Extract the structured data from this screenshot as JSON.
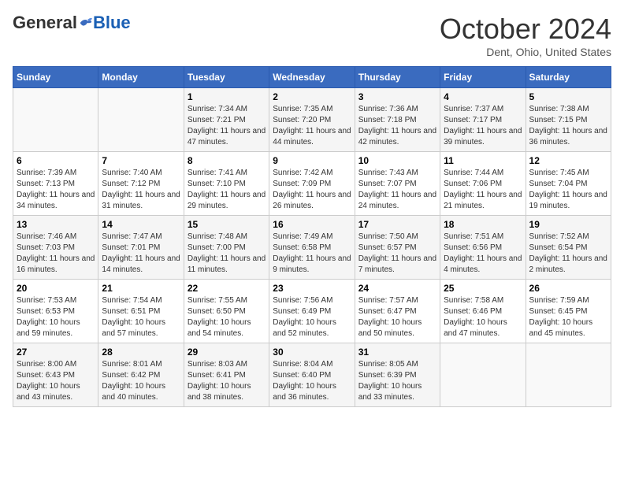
{
  "header": {
    "logo_general": "General",
    "logo_blue": "Blue",
    "month_title": "October 2024",
    "location": "Dent, Ohio, United States"
  },
  "days_of_week": [
    "Sunday",
    "Monday",
    "Tuesday",
    "Wednesday",
    "Thursday",
    "Friday",
    "Saturday"
  ],
  "weeks": [
    [
      {
        "day": "",
        "sunrise": "",
        "sunset": "",
        "daylight": ""
      },
      {
        "day": "",
        "sunrise": "",
        "sunset": "",
        "daylight": ""
      },
      {
        "day": "1",
        "sunrise": "Sunrise: 7:34 AM",
        "sunset": "Sunset: 7:21 PM",
        "daylight": "Daylight: 11 hours and 47 minutes."
      },
      {
        "day": "2",
        "sunrise": "Sunrise: 7:35 AM",
        "sunset": "Sunset: 7:20 PM",
        "daylight": "Daylight: 11 hours and 44 minutes."
      },
      {
        "day": "3",
        "sunrise": "Sunrise: 7:36 AM",
        "sunset": "Sunset: 7:18 PM",
        "daylight": "Daylight: 11 hours and 42 minutes."
      },
      {
        "day": "4",
        "sunrise": "Sunrise: 7:37 AM",
        "sunset": "Sunset: 7:17 PM",
        "daylight": "Daylight: 11 hours and 39 minutes."
      },
      {
        "day": "5",
        "sunrise": "Sunrise: 7:38 AM",
        "sunset": "Sunset: 7:15 PM",
        "daylight": "Daylight: 11 hours and 36 minutes."
      }
    ],
    [
      {
        "day": "6",
        "sunrise": "Sunrise: 7:39 AM",
        "sunset": "Sunset: 7:13 PM",
        "daylight": "Daylight: 11 hours and 34 minutes."
      },
      {
        "day": "7",
        "sunrise": "Sunrise: 7:40 AM",
        "sunset": "Sunset: 7:12 PM",
        "daylight": "Daylight: 11 hours and 31 minutes."
      },
      {
        "day": "8",
        "sunrise": "Sunrise: 7:41 AM",
        "sunset": "Sunset: 7:10 PM",
        "daylight": "Daylight: 11 hours and 29 minutes."
      },
      {
        "day": "9",
        "sunrise": "Sunrise: 7:42 AM",
        "sunset": "Sunset: 7:09 PM",
        "daylight": "Daylight: 11 hours and 26 minutes."
      },
      {
        "day": "10",
        "sunrise": "Sunrise: 7:43 AM",
        "sunset": "Sunset: 7:07 PM",
        "daylight": "Daylight: 11 hours and 24 minutes."
      },
      {
        "day": "11",
        "sunrise": "Sunrise: 7:44 AM",
        "sunset": "Sunset: 7:06 PM",
        "daylight": "Daylight: 11 hours and 21 minutes."
      },
      {
        "day": "12",
        "sunrise": "Sunrise: 7:45 AM",
        "sunset": "Sunset: 7:04 PM",
        "daylight": "Daylight: 11 hours and 19 minutes."
      }
    ],
    [
      {
        "day": "13",
        "sunrise": "Sunrise: 7:46 AM",
        "sunset": "Sunset: 7:03 PM",
        "daylight": "Daylight: 11 hours and 16 minutes."
      },
      {
        "day": "14",
        "sunrise": "Sunrise: 7:47 AM",
        "sunset": "Sunset: 7:01 PM",
        "daylight": "Daylight: 11 hours and 14 minutes."
      },
      {
        "day": "15",
        "sunrise": "Sunrise: 7:48 AM",
        "sunset": "Sunset: 7:00 PM",
        "daylight": "Daylight: 11 hours and 11 minutes."
      },
      {
        "day": "16",
        "sunrise": "Sunrise: 7:49 AM",
        "sunset": "Sunset: 6:58 PM",
        "daylight": "Daylight: 11 hours and 9 minutes."
      },
      {
        "day": "17",
        "sunrise": "Sunrise: 7:50 AM",
        "sunset": "Sunset: 6:57 PM",
        "daylight": "Daylight: 11 hours and 7 minutes."
      },
      {
        "day": "18",
        "sunrise": "Sunrise: 7:51 AM",
        "sunset": "Sunset: 6:56 PM",
        "daylight": "Daylight: 11 hours and 4 minutes."
      },
      {
        "day": "19",
        "sunrise": "Sunrise: 7:52 AM",
        "sunset": "Sunset: 6:54 PM",
        "daylight": "Daylight: 11 hours and 2 minutes."
      }
    ],
    [
      {
        "day": "20",
        "sunrise": "Sunrise: 7:53 AM",
        "sunset": "Sunset: 6:53 PM",
        "daylight": "Daylight: 10 hours and 59 minutes."
      },
      {
        "day": "21",
        "sunrise": "Sunrise: 7:54 AM",
        "sunset": "Sunset: 6:51 PM",
        "daylight": "Daylight: 10 hours and 57 minutes."
      },
      {
        "day": "22",
        "sunrise": "Sunrise: 7:55 AM",
        "sunset": "Sunset: 6:50 PM",
        "daylight": "Daylight: 10 hours and 54 minutes."
      },
      {
        "day": "23",
        "sunrise": "Sunrise: 7:56 AM",
        "sunset": "Sunset: 6:49 PM",
        "daylight": "Daylight: 10 hours and 52 minutes."
      },
      {
        "day": "24",
        "sunrise": "Sunrise: 7:57 AM",
        "sunset": "Sunset: 6:47 PM",
        "daylight": "Daylight: 10 hours and 50 minutes."
      },
      {
        "day": "25",
        "sunrise": "Sunrise: 7:58 AM",
        "sunset": "Sunset: 6:46 PM",
        "daylight": "Daylight: 10 hours and 47 minutes."
      },
      {
        "day": "26",
        "sunrise": "Sunrise: 7:59 AM",
        "sunset": "Sunset: 6:45 PM",
        "daylight": "Daylight: 10 hours and 45 minutes."
      }
    ],
    [
      {
        "day": "27",
        "sunrise": "Sunrise: 8:00 AM",
        "sunset": "Sunset: 6:43 PM",
        "daylight": "Daylight: 10 hours and 43 minutes."
      },
      {
        "day": "28",
        "sunrise": "Sunrise: 8:01 AM",
        "sunset": "Sunset: 6:42 PM",
        "daylight": "Daylight: 10 hours and 40 minutes."
      },
      {
        "day": "29",
        "sunrise": "Sunrise: 8:03 AM",
        "sunset": "Sunset: 6:41 PM",
        "daylight": "Daylight: 10 hours and 38 minutes."
      },
      {
        "day": "30",
        "sunrise": "Sunrise: 8:04 AM",
        "sunset": "Sunset: 6:40 PM",
        "daylight": "Daylight: 10 hours and 36 minutes."
      },
      {
        "day": "31",
        "sunrise": "Sunrise: 8:05 AM",
        "sunset": "Sunset: 6:39 PM",
        "daylight": "Daylight: 10 hours and 33 minutes."
      },
      {
        "day": "",
        "sunrise": "",
        "sunset": "",
        "daylight": ""
      },
      {
        "day": "",
        "sunrise": "",
        "sunset": "",
        "daylight": ""
      }
    ]
  ]
}
